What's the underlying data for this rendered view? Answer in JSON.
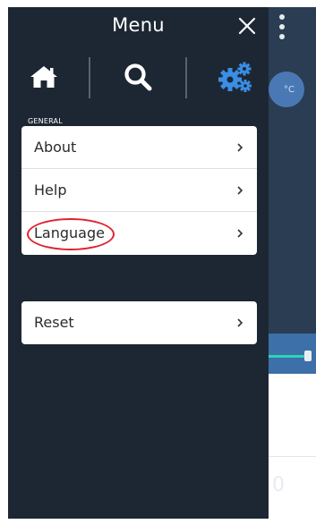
{
  "drawer": {
    "title": "Menu",
    "section_label": "GENERAL",
    "items": [
      {
        "label": "About"
      },
      {
        "label": "Help"
      },
      {
        "label": "Language"
      }
    ],
    "reset": {
      "label": "Reset"
    }
  },
  "nav": {
    "icons": [
      "home-icon",
      "search-icon",
      "gears-icon"
    ],
    "active": "gears-icon"
  },
  "colors": {
    "drawer_bg": "#1d2733",
    "accent": "#3a8ee6",
    "highlight": "#e0232f"
  }
}
